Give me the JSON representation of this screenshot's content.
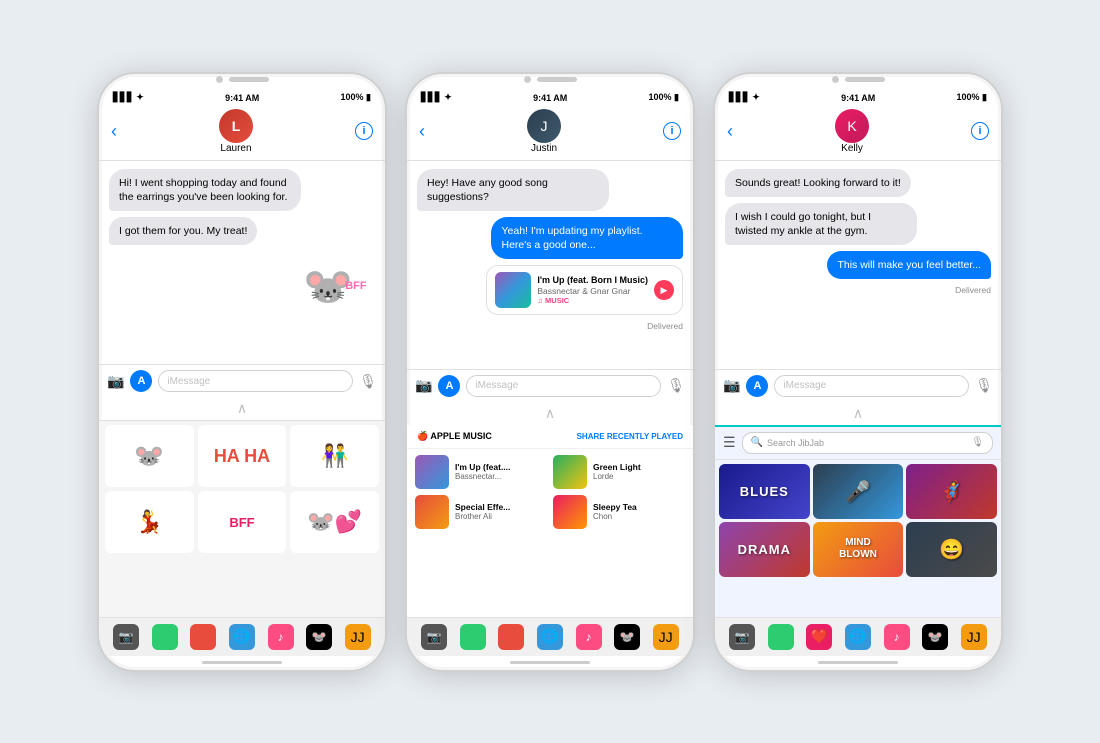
{
  "phones": [
    {
      "id": "phone1",
      "status_bar": {
        "signal": "▋▋▋ ✦",
        "time": "9:41 AM",
        "battery": "100% ▮"
      },
      "contact": {
        "name": "Lauren",
        "avatar_letter": "L"
      },
      "messages": [
        {
          "type": "received",
          "text": "Hi! I went shopping today and found the earrings you've been looking for."
        },
        {
          "type": "received",
          "text": "I got them for you. My treat!"
        },
        {
          "type": "sticker",
          "text": "BFF"
        }
      ],
      "input_placeholder": "iMessage",
      "drawer_type": "stickers",
      "dock_icons": [
        "📷",
        "🟢",
        "❤️",
        "🌐",
        "🎵",
        "🐭",
        "J"
      ]
    },
    {
      "id": "phone2",
      "status_bar": {
        "signal": "▋▋▋ ✦",
        "time": "9:41 AM",
        "battery": "100% ▮"
      },
      "contact": {
        "name": "Justin",
        "avatar_letter": "J"
      },
      "messages": [
        {
          "type": "received",
          "text": "Hey! Have any good song suggestions?"
        },
        {
          "type": "sent",
          "text": "Yeah! I'm updating my playlist. Here's a good one..."
        },
        {
          "type": "music_card",
          "title": "I'm Up (feat. Born I Music)",
          "artist": "Bassnectar & Gnar Gnar",
          "source": "♫ MUSIC"
        },
        {
          "type": "delivered_label",
          "text": "Delivered"
        }
      ],
      "input_placeholder": "iMessage",
      "drawer_type": "apple_music",
      "music_drawer": {
        "title": "APPLE MUSIC",
        "action": "SHARE RECENTLY PLAYED",
        "items": [
          {
            "title": "I'm Up (feat....",
            "artist": "Bassnectar..."
          },
          {
            "title": "Green Light",
            "artist": "Lorde"
          },
          {
            "title": "Special Effe...",
            "artist": "Brother Ali"
          },
          {
            "title": "Sleepy Tea",
            "artist": "Chon"
          }
        ]
      },
      "dock_icons": [
        "📷",
        "🟢",
        "❤️",
        "🌐",
        "🎵",
        "🐭",
        "J"
      ]
    },
    {
      "id": "phone3",
      "status_bar": {
        "signal": "▋▋▋ ✦",
        "time": "9:41 AM",
        "battery": "100% ▮"
      },
      "contact": {
        "name": "Kelly",
        "avatar_letter": "K"
      },
      "messages": [
        {
          "type": "received",
          "text": "Sounds great! Looking forward to it!"
        },
        {
          "type": "received",
          "text": "I wish I could go tonight, but I twisted my ankle at the gym."
        },
        {
          "type": "sent",
          "text": "This will make you feel better..."
        },
        {
          "type": "delivered_label",
          "text": "Delivered"
        }
      ],
      "input_placeholder": "iMessage",
      "drawer_type": "jibjab",
      "jibjab_search_placeholder": "Search JibJab",
      "jibjab_cells": [
        "BLUES",
        "",
        "DRAMA",
        "MIND BLOWN",
        ""
      ],
      "dock_icons": [
        "📷",
        "🟢",
        "❤️",
        "🌐",
        "🎵",
        "🐭",
        "J"
      ]
    }
  ]
}
